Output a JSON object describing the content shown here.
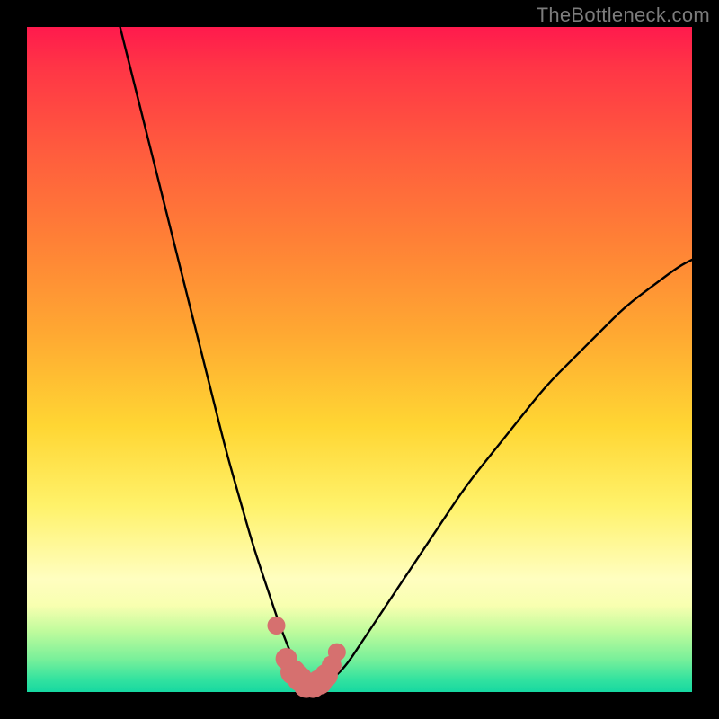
{
  "watermark": "TheBottleneck.com",
  "chart_data": {
    "type": "line",
    "title": "",
    "xlabel": "",
    "ylabel": "",
    "xlim": [
      0,
      100
    ],
    "ylim": [
      0,
      100
    ],
    "series": [
      {
        "name": "bottleneck-curve",
        "x": [
          14,
          16,
          18,
          20,
          22,
          24,
          26,
          28,
          30,
          32,
          34,
          36,
          38,
          40,
          41,
          42,
          43,
          44,
          46,
          48,
          50,
          54,
          58,
          62,
          66,
          70,
          74,
          78,
          82,
          86,
          90,
          94,
          98,
          100
        ],
        "values": [
          100,
          92,
          84,
          76,
          68,
          60,
          52,
          44,
          36,
          29,
          22,
          16,
          10,
          5,
          3,
          2,
          1,
          1,
          2,
          4,
          7,
          13,
          19,
          25,
          31,
          36,
          41,
          46,
          50,
          54,
          58,
          61,
          64,
          65
        ]
      }
    ],
    "markers": {
      "name": "highlight-dots",
      "color": "#d6706f",
      "x": [
        37.5,
        39,
        40,
        41,
        42,
        43,
        44,
        45,
        45.8,
        46.6
      ],
      "values": [
        10,
        5,
        3,
        2,
        1,
        1,
        1.5,
        2.5,
        4,
        6
      ],
      "size": [
        10,
        12,
        14,
        14,
        14,
        14,
        14,
        13,
        11,
        10
      ]
    }
  },
  "colors": {
    "curve_stroke": "#000000",
    "marker_fill": "#d6706f",
    "background_black": "#000000"
  }
}
